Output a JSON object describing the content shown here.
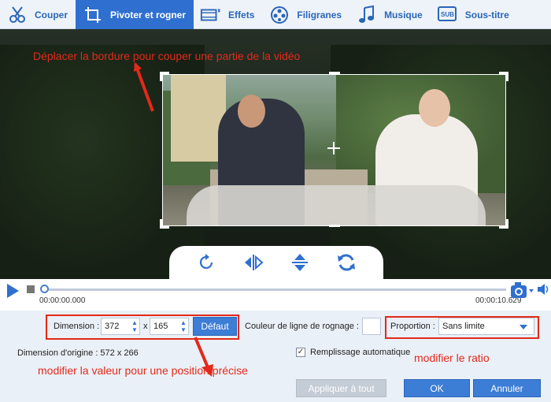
{
  "colors": {
    "accent": "#2f6fd0",
    "annotation": "#e3291a",
    "panel": "#eaf0f7"
  },
  "tabs": [
    {
      "label": "Couper",
      "icon": "scissors-icon",
      "active": false
    },
    {
      "label": "Pivoter et rogner",
      "icon": "rotate-crop-icon",
      "active": true
    },
    {
      "label": "Effets",
      "icon": "film-effects-icon",
      "active": false
    },
    {
      "label": "Filigranes",
      "icon": "film-reel-icon",
      "active": false
    },
    {
      "label": "Musique",
      "icon": "music-note-icon",
      "active": false
    },
    {
      "label": "Sous-titre",
      "icon": "subtitle-icon",
      "active": false
    }
  ],
  "annotations": {
    "crop_hint": "Déplacer la bordure pour couper une partie de la vidéo",
    "position_hint": "modifier la valeur pour une position précise",
    "ratio_hint": "modifier le ratio"
  },
  "player": {
    "current_time": "00:00:00.000",
    "total_time": "00:00:10.629"
  },
  "crop_settings": {
    "dimension_label": "Dimension :",
    "width": "372",
    "separator": "x",
    "height": "165",
    "default_button": "Défaut",
    "line_color_label": "Couleur de ligne de rognage :",
    "proportion_label": "Proportion :",
    "proportion_value": "Sans limite",
    "original_dimension": "Dimension d'origine : 572 x 266",
    "auto_fill_label": "Remplissage automatique",
    "auto_fill_checked": true
  },
  "buttons": {
    "apply_all": "Appliquer à tout",
    "ok": "OK",
    "cancel": "Annuler"
  }
}
